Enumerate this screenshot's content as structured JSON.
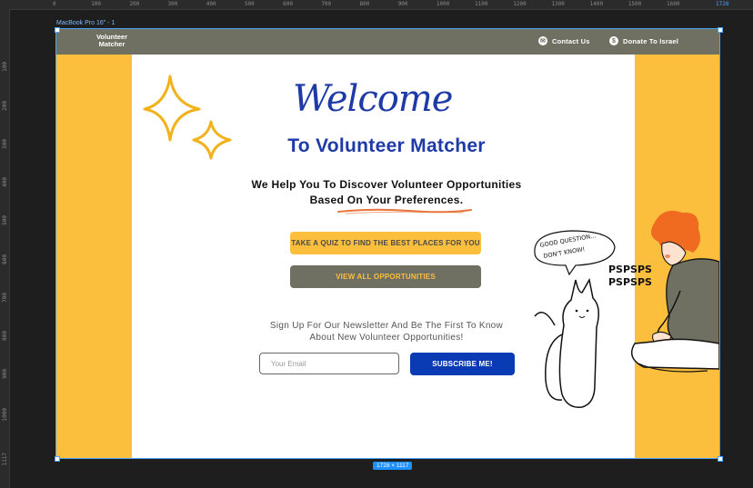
{
  "ruler": {
    "top_ticks": [
      "0",
      "100",
      "200",
      "300",
      "400",
      "500",
      "600",
      "700",
      "800",
      "900",
      "1000",
      "1100",
      "1200",
      "1300",
      "1400",
      "1500",
      "1600",
      "1728"
    ],
    "left_ticks": [
      "100",
      "200",
      "300",
      "400",
      "500",
      "600",
      "700",
      "800",
      "900",
      "1000",
      "1117"
    ]
  },
  "frame": {
    "label": "MacBook Pro 16\" - 1",
    "size_badge": "1728 × 1117"
  },
  "nav": {
    "logo_line1": "Volunteer",
    "logo_line2": "Matcher",
    "contact_label": "Contact Us",
    "donate_label": "Donate To Israel"
  },
  "hero": {
    "welcome": "Welcome",
    "headline": "To Volunteer Matcher",
    "sub_line1": "We Help You To Discover Volunteer Opportunities",
    "sub_line2": "Based On Your Preferences."
  },
  "actions": {
    "quiz_label": "TAKE A QUIZ TO FIND THE BEST PLACES FOR YOU",
    "view_all_label": "VIEW ALL OPPORTUNITIES"
  },
  "newsletter": {
    "line1": "Sign Up For Our Newsletter And Be The First To Know",
    "line2": "About New Volunteer Opportunities!",
    "email_placeholder": "Your Email",
    "subscribe_label": "SUBSCRIBE ME!"
  },
  "illustration": {
    "bubble_line1": "GOOD QUESTION...",
    "bubble_line2": "DON'T KNOW!",
    "psps_line1": "PSPSPS",
    "psps_line2": "PSPSPS"
  },
  "colors": {
    "accent_yellow": "#fbbf3d",
    "nav_gray": "#6f6f62",
    "brand_blue": "#1d3aa6",
    "button_blue": "#0a3bb4"
  }
}
